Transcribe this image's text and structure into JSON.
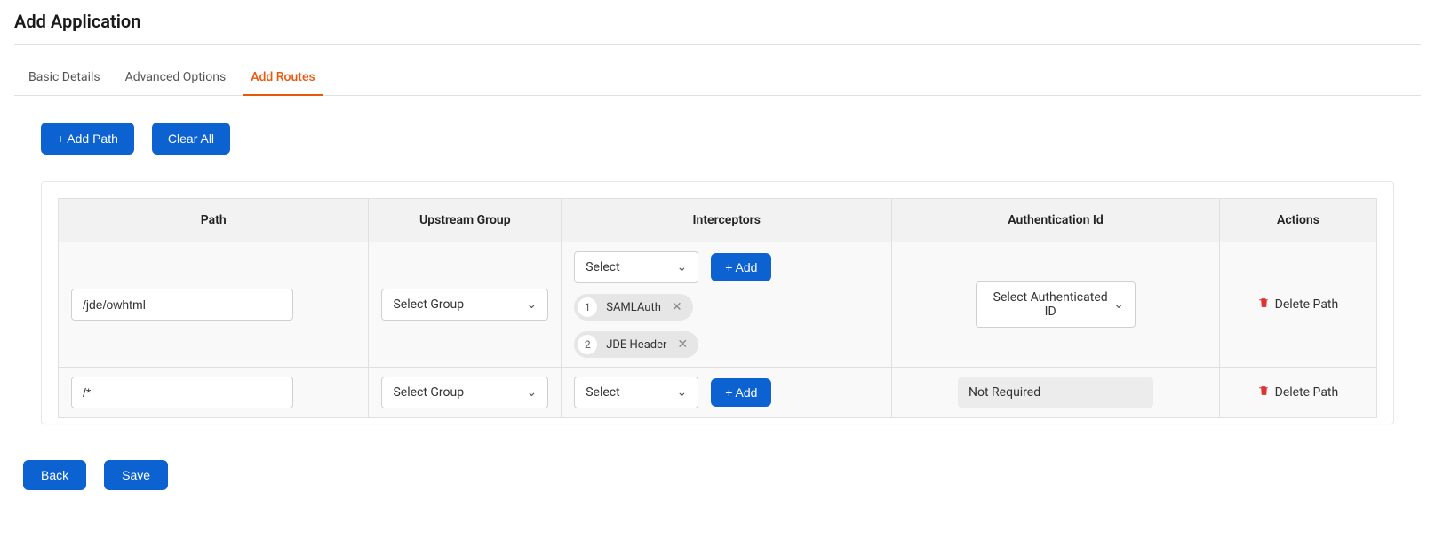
{
  "page_title": "Add Application",
  "tabs": [
    {
      "label": "Basic Details",
      "active": false
    },
    {
      "label": "Advanced Options",
      "active": false
    },
    {
      "label": "Add Routes",
      "active": true
    }
  ],
  "toolbar": {
    "add_path_label": "+ Add Path",
    "clear_all_label": "Clear All"
  },
  "table": {
    "headers": {
      "path": "Path",
      "upstream_group": "Upstream Group",
      "interceptors": "Interceptors",
      "auth_id": "Authentication Id",
      "actions": "Actions"
    },
    "select_group_placeholder": "Select Group",
    "select_placeholder": "Select",
    "add_label": "+ Add",
    "auth_select_placeholder": "Select Authenticated ID",
    "delete_label": "Delete Path",
    "rows": [
      {
        "path_value": "/jde/owhtml",
        "interceptors": [
          {
            "num": "1",
            "label": "SAMLAuth"
          },
          {
            "num": "2",
            "label": "JDE Header"
          }
        ],
        "auth_mode": "select"
      },
      {
        "path_value": "/*",
        "interceptors": [],
        "auth_mode": "readonly",
        "auth_value": "Not Required"
      }
    ]
  },
  "footer": {
    "back_label": "Back",
    "save_label": "Save"
  }
}
